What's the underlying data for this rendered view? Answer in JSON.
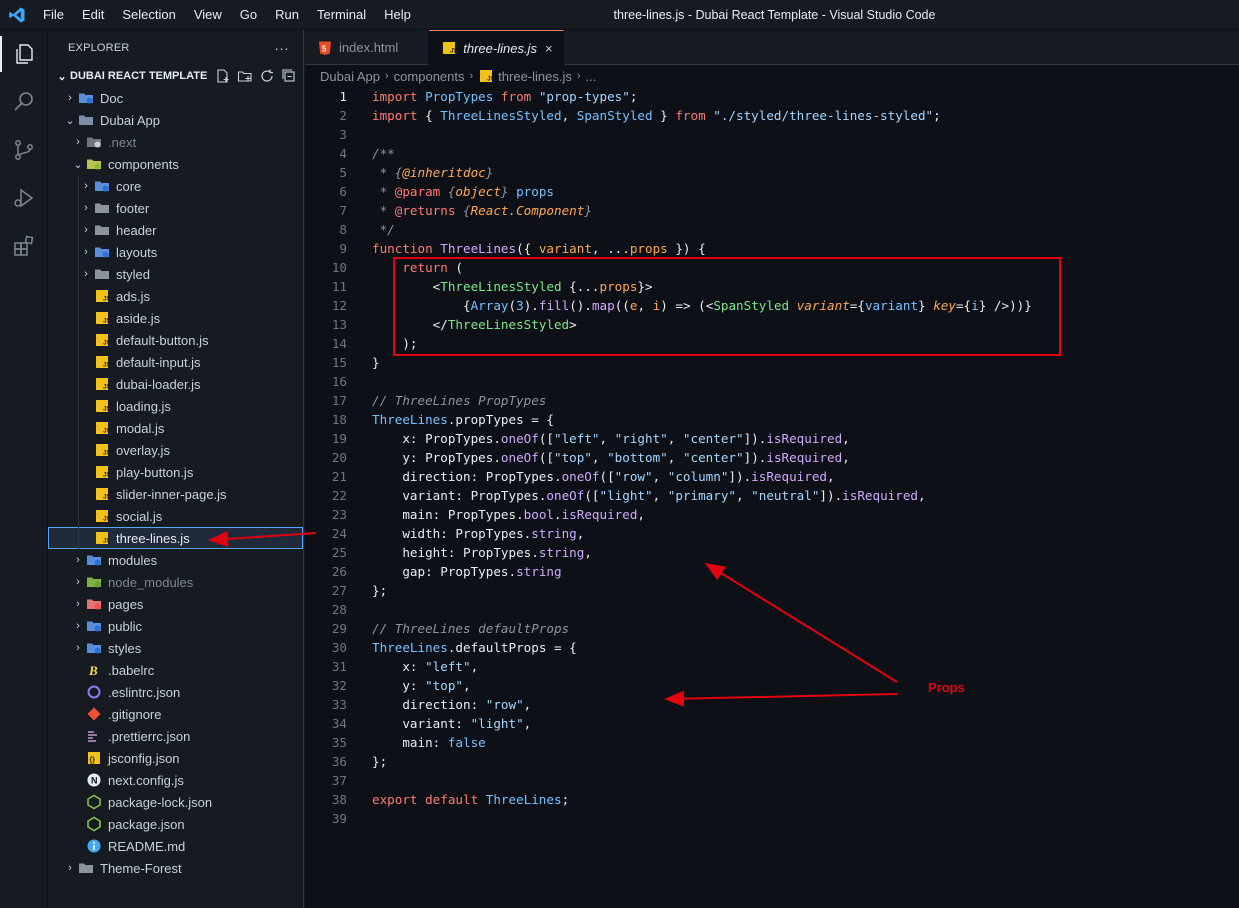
{
  "window": {
    "title": "three-lines.js - Dubai React Template - Visual Studio Code"
  },
  "menu": [
    "File",
    "Edit",
    "Selection",
    "View",
    "Go",
    "Run",
    "Terminal",
    "Help"
  ],
  "activity": [
    "explorer-icon",
    "search-icon",
    "source-control-icon",
    "run-debug-icon",
    "extensions-icon"
  ],
  "explorer": {
    "title": "EXPLORER",
    "more": "···",
    "project": "DUBAI REACT TEMPLATE",
    "items": [
      {
        "label": "Doc",
        "chev": "›",
        "icon": "folder-blue",
        "depth": 0
      },
      {
        "label": "Dubai App",
        "chev": "⌄",
        "icon": "folder-open",
        "depth": 0
      },
      {
        "label": ".next",
        "chev": "›",
        "icon": "folder-next",
        "depth": 1,
        "dim": true
      },
      {
        "label": "components",
        "chev": "⌄",
        "icon": "folder-components",
        "depth": 1
      },
      {
        "label": "core",
        "chev": "›",
        "icon": "folder-blue",
        "depth": 2
      },
      {
        "label": "footer",
        "chev": "›",
        "icon": "folder-gray",
        "depth": 2
      },
      {
        "label": "header",
        "chev": "›",
        "icon": "folder-gray",
        "depth": 2
      },
      {
        "label": "layouts",
        "chev": "›",
        "icon": "folder-blue",
        "depth": 2
      },
      {
        "label": "styled",
        "chev": "›",
        "icon": "folder-gray",
        "depth": 2
      },
      {
        "label": "ads.js",
        "icon": "js",
        "depth": 2
      },
      {
        "label": "aside.js",
        "icon": "js",
        "depth": 2
      },
      {
        "label": "default-button.js",
        "icon": "js",
        "depth": 2
      },
      {
        "label": "default-input.js",
        "icon": "js",
        "depth": 2
      },
      {
        "label": "dubai-loader.js",
        "icon": "js",
        "depth": 2
      },
      {
        "label": "loading.js",
        "icon": "js",
        "depth": 2
      },
      {
        "label": "modal.js",
        "icon": "js",
        "depth": 2
      },
      {
        "label": "overlay.js",
        "icon": "js",
        "depth": 2
      },
      {
        "label": "play-button.js",
        "icon": "js",
        "depth": 2
      },
      {
        "label": "slider-inner-page.js",
        "icon": "js",
        "depth": 2
      },
      {
        "label": "social.js",
        "icon": "js",
        "depth": 2
      },
      {
        "label": "three-lines.js",
        "icon": "js",
        "depth": 2,
        "selected": true
      },
      {
        "label": "modules",
        "chev": "›",
        "icon": "folder-blue",
        "depth": 1
      },
      {
        "label": "node_modules",
        "chev": "›",
        "icon": "folder-green",
        "depth": 1,
        "dim": true
      },
      {
        "label": "pages",
        "chev": "›",
        "icon": "folder-red",
        "depth": 1
      },
      {
        "label": "public",
        "chev": "›",
        "icon": "folder-blue",
        "depth": 1
      },
      {
        "label": "styles",
        "chev": "›",
        "icon": "folder-blue",
        "depth": 1
      },
      {
        "label": ".babelrc",
        "icon": "babel",
        "depth": 1
      },
      {
        "label": ".eslintrc.json",
        "icon": "eslint",
        "depth": 1
      },
      {
        "label": ".gitignore",
        "icon": "git",
        "depth": 1
      },
      {
        "label": ".prettierrc.json",
        "icon": "prettier",
        "depth": 1
      },
      {
        "label": "jsconfig.json",
        "icon": "jsconfig",
        "depth": 1
      },
      {
        "label": "next.config.js",
        "icon": "next",
        "depth": 1
      },
      {
        "label": "package-lock.json",
        "icon": "node",
        "depth": 1
      },
      {
        "label": "package.json",
        "icon": "node",
        "depth": 1
      },
      {
        "label": "README.md",
        "icon": "info",
        "depth": 1
      },
      {
        "label": "Theme-Forest",
        "chev": "›",
        "icon": "folder-gray",
        "depth": 0
      }
    ]
  },
  "tabs": [
    {
      "label": "index.html",
      "icon": "html",
      "active": false
    },
    {
      "label": "three-lines.js",
      "icon": "js",
      "active": true,
      "close": "×"
    }
  ],
  "breadcrumb": [
    "Dubai App",
    "components",
    "three-lines.js",
    "..."
  ],
  "code": {
    "current_line": 1,
    "lines": [
      [
        [
          "kw",
          "import "
        ],
        [
          "blue",
          "PropTypes "
        ],
        [
          "kw",
          "from "
        ],
        [
          "str",
          "\"prop-types\""
        ],
        [
          "plain",
          ";"
        ]
      ],
      [
        [
          "kw",
          "import "
        ],
        [
          "plain",
          "{ "
        ],
        [
          "blue",
          "ThreeLinesStyled"
        ],
        [
          "plain",
          ", "
        ],
        [
          "blue",
          "SpanStyled"
        ],
        [
          "plain",
          " } "
        ],
        [
          "kw",
          "from "
        ],
        [
          "str",
          "\"./styled/three-lines-styled\""
        ],
        [
          "plain",
          ";"
        ]
      ],
      [],
      [
        [
          "cmt",
          "/**"
        ]
      ],
      [
        [
          "cmt",
          " * {"
        ],
        [
          "ital",
          "@inheritdoc"
        ],
        [
          "cmt",
          "}"
        ]
      ],
      [
        [
          "cmt",
          " * "
        ],
        [
          "kw",
          "@param "
        ],
        [
          "cmt",
          "{"
        ],
        [
          "ital",
          "object"
        ],
        [
          "cmt",
          "} "
        ],
        [
          "blue",
          "props"
        ]
      ],
      [
        [
          "cmt",
          " * "
        ],
        [
          "kw",
          "@returns "
        ],
        [
          "cmt",
          "{"
        ],
        [
          "ital",
          "React.Component"
        ],
        [
          "cmt",
          "}"
        ]
      ],
      [
        [
          "cmt",
          " */"
        ]
      ],
      [
        [
          "kw",
          "function "
        ],
        [
          "fn",
          "ThreeLines"
        ],
        [
          "plain",
          "({ "
        ],
        [
          "var",
          "variant"
        ],
        [
          "plain",
          ", ..."
        ],
        [
          "var",
          "props"
        ],
        [
          "plain",
          " }) {"
        ]
      ],
      [
        [
          "plain",
          "    "
        ],
        [
          "kw",
          "return "
        ],
        [
          "plain",
          "("
        ]
      ],
      [
        [
          "plain",
          "        <"
        ],
        [
          "green",
          "ThreeLinesStyled "
        ],
        [
          "plain",
          "{..."
        ],
        [
          "var",
          "props"
        ],
        [
          "plain",
          "}>"
        ]
      ],
      [
        [
          "plain",
          "            {"
        ],
        [
          "blue",
          "Array"
        ],
        [
          "plain",
          "("
        ],
        [
          "blue",
          "3"
        ],
        [
          "plain",
          ")."
        ],
        [
          "fn",
          "fill"
        ],
        [
          "plain",
          "()."
        ],
        [
          "fn",
          "map"
        ],
        [
          "plain",
          "(("
        ],
        [
          "var",
          "e"
        ],
        [
          "plain",
          ", "
        ],
        [
          "var",
          "i"
        ],
        [
          "plain",
          ") => (<"
        ],
        [
          "green",
          "SpanStyled "
        ],
        [
          "ital",
          "variant"
        ],
        [
          "plain",
          "={"
        ],
        [
          "blue",
          "variant"
        ],
        [
          "plain",
          "} "
        ],
        [
          "ital",
          "key"
        ],
        [
          "plain",
          "={"
        ],
        [
          "blue",
          "i"
        ],
        [
          "plain",
          "} />))}"
        ]
      ],
      [
        [
          "plain",
          "        </"
        ],
        [
          "green",
          "ThreeLinesStyled"
        ],
        [
          "plain",
          ">"
        ]
      ],
      [
        [
          "plain",
          "    );"
        ]
      ],
      [
        [
          "plain",
          "}"
        ]
      ],
      [],
      [
        [
          "cmt",
          "// ThreeLines PropTypes"
        ]
      ],
      [
        [
          "blue",
          "ThreeLines"
        ],
        [
          "plain",
          "."
        ],
        [
          "plain",
          "propTypes = {"
        ]
      ],
      [
        [
          "plain",
          "    x: "
        ],
        [
          "plain",
          "PropTypes."
        ],
        [
          "fn",
          "oneOf"
        ],
        [
          "plain",
          "(["
        ],
        [
          "str",
          "\"left\""
        ],
        [
          "plain",
          ", "
        ],
        [
          "str",
          "\"right\""
        ],
        [
          "plain",
          ", "
        ],
        [
          "str",
          "\"center\""
        ],
        [
          "plain",
          "])."
        ],
        [
          "fn",
          "isRequired"
        ],
        [
          "plain",
          ","
        ]
      ],
      [
        [
          "plain",
          "    y: "
        ],
        [
          "plain",
          "PropTypes."
        ],
        [
          "fn",
          "oneOf"
        ],
        [
          "plain",
          "(["
        ],
        [
          "str",
          "\"top\""
        ],
        [
          "plain",
          ", "
        ],
        [
          "str",
          "\"bottom\""
        ],
        [
          "plain",
          ", "
        ],
        [
          "str",
          "\"center\""
        ],
        [
          "plain",
          "])."
        ],
        [
          "fn",
          "isRequired"
        ],
        [
          "plain",
          ","
        ]
      ],
      [
        [
          "plain",
          "    direction: "
        ],
        [
          "plain",
          "PropTypes."
        ],
        [
          "fn",
          "oneOf"
        ],
        [
          "plain",
          "(["
        ],
        [
          "str",
          "\"row\""
        ],
        [
          "plain",
          ", "
        ],
        [
          "str",
          "\"column\""
        ],
        [
          "plain",
          "])."
        ],
        [
          "fn",
          "isRequired"
        ],
        [
          "plain",
          ","
        ]
      ],
      [
        [
          "plain",
          "    variant: "
        ],
        [
          "plain",
          "PropTypes."
        ],
        [
          "fn",
          "oneOf"
        ],
        [
          "plain",
          "(["
        ],
        [
          "str",
          "\"light\""
        ],
        [
          "plain",
          ", "
        ],
        [
          "str",
          "\"primary\""
        ],
        [
          "plain",
          ", "
        ],
        [
          "str",
          "\"neutral\""
        ],
        [
          "plain",
          "])."
        ],
        [
          "fn",
          "isRequired"
        ],
        [
          "plain",
          ","
        ]
      ],
      [
        [
          "plain",
          "    main: "
        ],
        [
          "plain",
          "PropTypes."
        ],
        [
          "fn",
          "bool"
        ],
        [
          "plain",
          "."
        ],
        [
          "fn",
          "isRequired"
        ],
        [
          "plain",
          ","
        ]
      ],
      [
        [
          "plain",
          "    width: "
        ],
        [
          "plain",
          "PropTypes."
        ],
        [
          "fn",
          "string"
        ],
        [
          "plain",
          ","
        ]
      ],
      [
        [
          "plain",
          "    height: "
        ],
        [
          "plain",
          "PropTypes."
        ],
        [
          "fn",
          "string"
        ],
        [
          "plain",
          ","
        ]
      ],
      [
        [
          "plain",
          "    gap: "
        ],
        [
          "plain",
          "PropTypes."
        ],
        [
          "fn",
          "string"
        ]
      ],
      [
        [
          "plain",
          "};"
        ]
      ],
      [],
      [
        [
          "cmt",
          "// ThreeLines defaultProps"
        ]
      ],
      [
        [
          "blue",
          "ThreeLines"
        ],
        [
          "plain",
          "."
        ],
        [
          "plain",
          "defaultProps = {"
        ]
      ],
      [
        [
          "plain",
          "    x: "
        ],
        [
          "str",
          "\"left\""
        ],
        [
          "plain",
          ","
        ]
      ],
      [
        [
          "plain",
          "    y: "
        ],
        [
          "str",
          "\"top\""
        ],
        [
          "plain",
          ","
        ]
      ],
      [
        [
          "plain",
          "    direction: "
        ],
        [
          "str",
          "\"row\""
        ],
        [
          "plain",
          ","
        ]
      ],
      [
        [
          "plain",
          "    variant: "
        ],
        [
          "str",
          "\"light\""
        ],
        [
          "plain",
          ","
        ]
      ],
      [
        [
          "plain",
          "    main: "
        ],
        [
          "blue",
          "false"
        ]
      ],
      [
        [
          "plain",
          "};"
        ]
      ],
      [],
      [
        [
          "kw",
          "export default "
        ],
        [
          "blue",
          "ThreeLines"
        ],
        [
          "plain",
          ";"
        ]
      ],
      []
    ]
  },
  "annotation": {
    "label": "Props",
    "color": "#e3000f"
  }
}
